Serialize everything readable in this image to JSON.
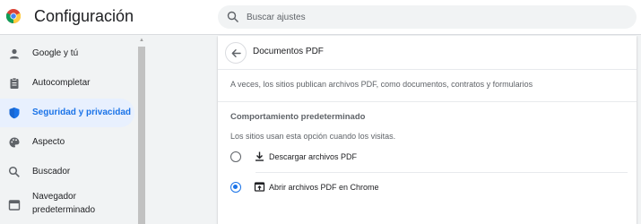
{
  "header": {
    "title": "Configuración",
    "logo_icon": "chrome-logo",
    "search": {
      "placeholder": "Buscar ajustes",
      "icon": "search-icon"
    }
  },
  "sidebar": {
    "items": [
      {
        "label": "Google y tú",
        "icon": "person-icon",
        "active": false
      },
      {
        "label": "Autocompletar",
        "icon": "clipboard-icon",
        "active": false
      },
      {
        "label": "Seguridad y privacidad",
        "icon": "shield-icon",
        "active": true
      },
      {
        "label": "Aspecto",
        "icon": "palette-icon",
        "active": false
      },
      {
        "label": "Buscador",
        "icon": "search-icon",
        "active": false
      },
      {
        "label_line1": "Navegador",
        "label_line2": "predeterminado",
        "icon": "browser-icon",
        "active": false
      }
    ]
  },
  "panel": {
    "title": "Documentos PDF",
    "back_icon": "back-arrow-icon",
    "description": "A veces, los sitios publican archivos PDF, como documentos, contratos y formularios",
    "section_heading": "Comportamiento predeterminado",
    "section_subtext": "Los sitios usan esta opción cuando los visitas.",
    "options": [
      {
        "label": "Descargar archivos PDF",
        "icon": "download-icon",
        "selected": false
      },
      {
        "label": "Abrir archivos PDF en Chrome",
        "icon": "open-in-browser-icon",
        "selected": true
      }
    ]
  },
  "colors": {
    "accent": "#1a73e8",
    "active_bg": "#e8f0fe",
    "text_primary": "#202124",
    "text_secondary": "#5f6368",
    "page_bg": "#f1f3f4"
  }
}
